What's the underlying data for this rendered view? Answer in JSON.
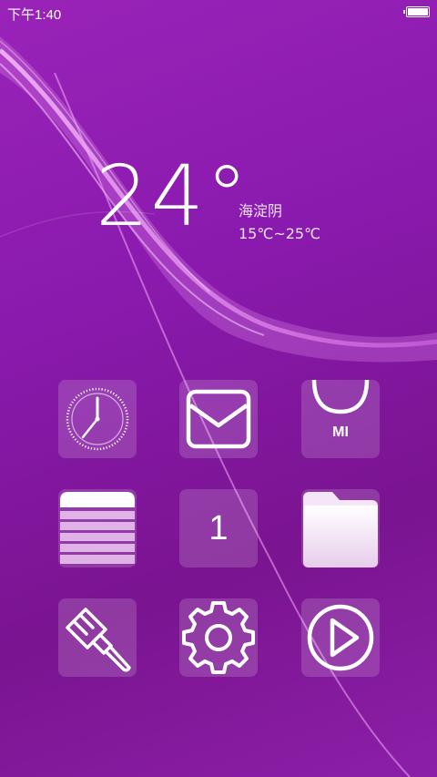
{
  "status_bar": {
    "time": "下午1:40",
    "battery_level": 1.0
  },
  "weather": {
    "temperature": "24°",
    "city": "海淀阴",
    "range": "15℃~25℃"
  },
  "apps": [
    {
      "name": "clock",
      "icon": "clock-icon"
    },
    {
      "name": "mail",
      "icon": "mail-icon"
    },
    {
      "name": "mi-store",
      "icon": "shopping-bag-icon",
      "label": "MI"
    },
    {
      "name": "notes",
      "icon": "notes-icon"
    },
    {
      "name": "calendar",
      "icon": "calendar-icon",
      "label": "1"
    },
    {
      "name": "file-manager",
      "icon": "folder-icon"
    },
    {
      "name": "themes",
      "icon": "paintbrush-icon"
    },
    {
      "name": "settings",
      "icon": "gear-icon"
    },
    {
      "name": "video",
      "icon": "play-icon"
    }
  ],
  "colors": {
    "background": "#8a1aae",
    "accent_wave": "#e9a6f2",
    "icon": "#ffffff"
  }
}
